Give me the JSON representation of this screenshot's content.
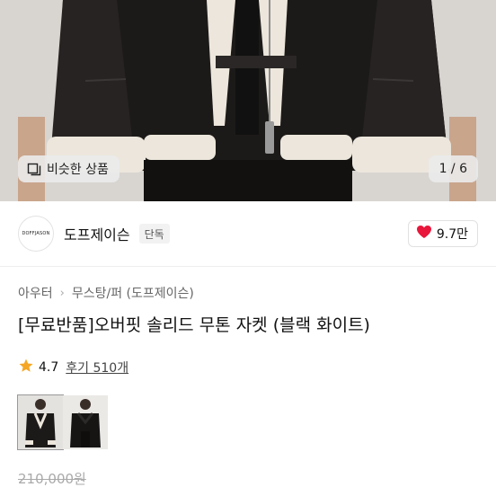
{
  "hero": {
    "similar_label": "비슷한 상품",
    "counter": "1 / 6"
  },
  "store": {
    "logo_text": "DOFFJASON",
    "name": "도프제이슨",
    "badge": "단독",
    "likes": "9.7만"
  },
  "breadcrumb": [
    "아우터",
    "무스탕/퍼 (도프제이슨)"
  ],
  "product": {
    "title": "[무료반품]오버핏 솔리드 무톤 자켓 (블랙 화이트)",
    "rating": "4.7",
    "reviews": "후기 510개",
    "original_price": "210,000원"
  },
  "colors": {
    "heart": "#e8173b",
    "star": "#f5a623"
  },
  "icons": {
    "similar": "similar-items-icon",
    "like": "heart-icon",
    "rating": "star-icon",
    "breadcrumb_sep": "chevron-right-icon"
  }
}
